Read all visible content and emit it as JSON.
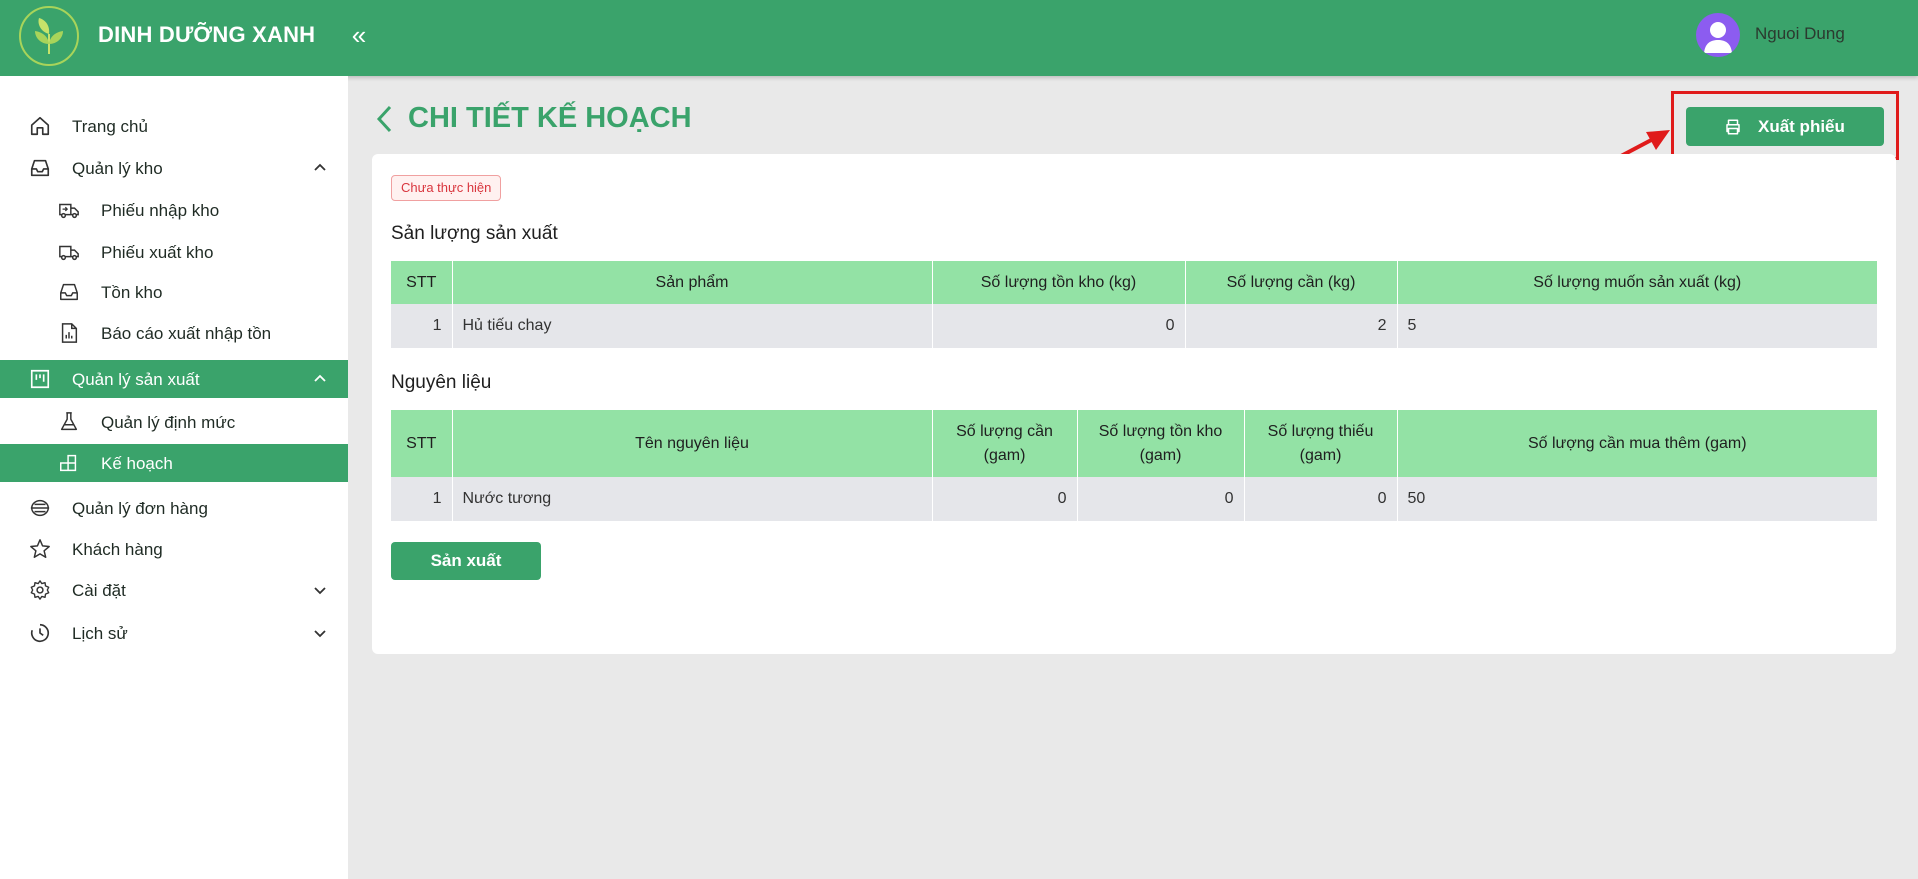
{
  "header": {
    "brand": "DINH DƯỠNG XANH",
    "collapse_glyph": "«",
    "user_name": "Nguoi Dung",
    "colors": {
      "primary": "#3aa36b",
      "avatar": "#8c5cf0"
    }
  },
  "sidebar": {
    "items": [
      {
        "label": "Trang chủ",
        "icon": "home-icon"
      },
      {
        "label": "Quản lý kho",
        "icon": "inbox-icon",
        "expanded": true
      },
      {
        "label": "Phiếu nhập kho",
        "icon": "truck-in-icon"
      },
      {
        "label": "Phiếu xuất kho",
        "icon": "truck-out-icon"
      },
      {
        "label": "Tồn kho",
        "icon": "inbox-icon"
      },
      {
        "label": "Báo cáo xuất nhập tồn",
        "icon": "report-icon"
      },
      {
        "label": "Quản lý sản xuất",
        "icon": "factory-icon",
        "expanded": true,
        "active": true
      },
      {
        "label": "Quản lý định mức",
        "icon": "flask-icon"
      },
      {
        "label": "Kế hoạch",
        "icon": "blocks-icon",
        "active": true
      },
      {
        "label": "Quản lý đơn hàng",
        "icon": "order-icon"
      },
      {
        "label": "Khách hàng",
        "icon": "star-icon"
      },
      {
        "label": "Cài đặt",
        "icon": "gear-icon",
        "expanded": false
      },
      {
        "label": "Lịch sử",
        "icon": "clock-icon",
        "expanded": false
      }
    ]
  },
  "page": {
    "title": "CHI TIẾT KẾ HOẠCH",
    "export_label": "Xuất phiếu",
    "status": "Chưa thực hiện",
    "produce_label": "Sản xuất"
  },
  "production": {
    "title": "Sản lượng sản xuất",
    "headers": [
      "STT",
      "Sản phẩm",
      "Số lượng tồn kho (kg)",
      "Số lượng cần (kg)",
      "Số lượng muốn sản xuất (kg)"
    ],
    "rows": [
      {
        "stt": "1",
        "product": "Hủ tiếu chay",
        "stock": "0",
        "need": "2",
        "want": "5"
      }
    ]
  },
  "materials": {
    "title": "Nguyên liệu",
    "headers": [
      "STT",
      "Tên nguyên liệu",
      "Số lượng cần (gam)",
      "Số lượng tồn kho (gam)",
      "Số lượng thiếu (gam)",
      "Số lượng cần mua thêm (gam)"
    ],
    "rows": [
      {
        "stt": "1",
        "name": "Nước tương",
        "need": "0",
        "stock": "0",
        "missing": "0",
        "buy": "50"
      }
    ]
  }
}
